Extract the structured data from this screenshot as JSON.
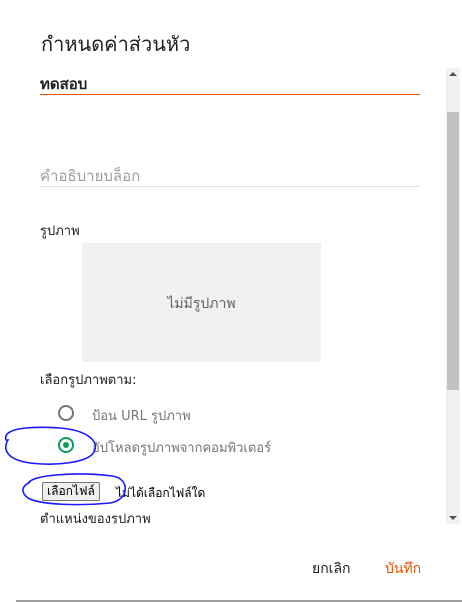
{
  "dialog": {
    "title": "กำหนดค่าส่วนหัว",
    "title_field_value": "ทดสอบ",
    "description_placeholder": "คำอธิบายบล็อก",
    "image_label": "รูปภาพ",
    "image_placeholder_text": "ไม่มีรูปภาพ",
    "choose_image_label": "เลือกรูปภาพตาม:",
    "options": [
      {
        "label": "ป้อน URL รูปภาพ",
        "selected": false
      },
      {
        "label": "อัปโหลดรูปภาพจากคอมพิวเตอร์",
        "selected": true
      }
    ],
    "file_button_label": "เลือกไฟล์",
    "file_status": "ไม่ได้เลือกไฟล์ใด",
    "position_label": "ตำแหน่งของรูปภาพ",
    "cancel_label": "ยกเลิก",
    "save_label": "บันทึก"
  },
  "colors": {
    "accent": "#e65100",
    "radio_selected": "#0f9d58",
    "annotation": "#1a1aff"
  }
}
